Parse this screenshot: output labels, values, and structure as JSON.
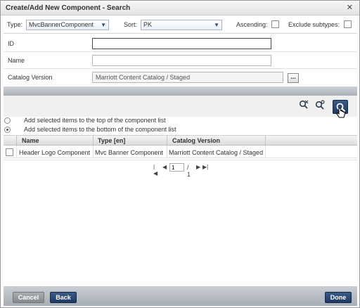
{
  "dialog": {
    "title": "Create/Add New Component - Search",
    "close_icon": "close-icon"
  },
  "filters": {
    "type_label": "Type:",
    "type_value": "MvcBannerComponent",
    "sort_label": "Sort:",
    "sort_value": "PK",
    "ascending_label": "Ascending:",
    "ascending_checked": false,
    "exclude_label": "Exclude subtypes:",
    "exclude_checked": false
  },
  "form": {
    "id_label": "ID",
    "id_value": "",
    "name_label": "Name",
    "name_value": "",
    "catalog_label": "Catalog Version",
    "catalog_value": "Marriott Content Catalog / Staged",
    "browse_label": "..."
  },
  "toolbar": {
    "icons": [
      "clear-search-icon",
      "advanced-search-icon",
      "search-icon"
    ]
  },
  "options": {
    "top_label": "Add selected items to the top of the component list",
    "bottom_label": "Add selected items to the bottom of the component list",
    "selected": "bottom"
  },
  "grid": {
    "columns": [
      "Name",
      "Type [en]",
      "Catalog Version"
    ],
    "rows": [
      {
        "name": "Header Logo Component",
        "type": "Mvc Banner Component",
        "catalog": "Marriott Content Catalog / Staged"
      }
    ]
  },
  "pager": {
    "page": "1",
    "total": "/ 1"
  },
  "footer": {
    "cancel_label": "Cancel",
    "back_label": "Back",
    "done_label": "Done"
  }
}
